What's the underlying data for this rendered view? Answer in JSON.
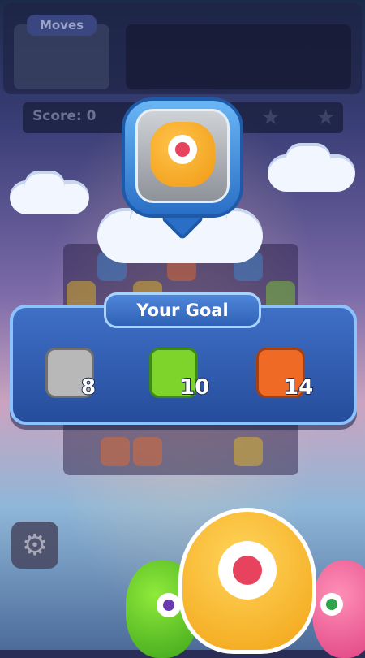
{
  "hud": {
    "moves_label": "Moves",
    "score_label": "Score: 0"
  },
  "goal_panel": {
    "title": "Your Goal",
    "items": [
      {
        "icon": "stone-block-icon",
        "count": "8",
        "color": "#b8b8b8"
      },
      {
        "icon": "green-monster-icon",
        "count": "10",
        "color": "#7fd42c"
      },
      {
        "icon": "red-monster-icon",
        "count": "14",
        "color": "#ee6a25"
      }
    ]
  },
  "target_icon": "orange-monster-icon",
  "settings_icon": "gear-icon",
  "colors": {
    "panel": "#2f5db3",
    "panel_border": "#8cc3ff",
    "bubble": "#3a86d8"
  }
}
